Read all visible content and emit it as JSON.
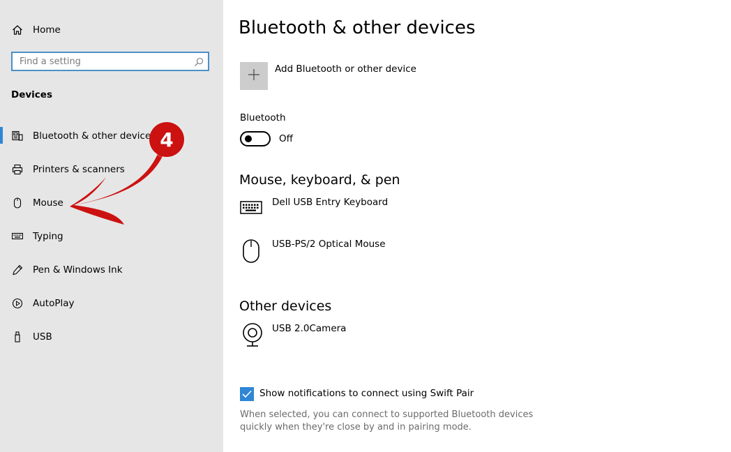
{
  "sidebar": {
    "home_label": "Home",
    "search_placeholder": "Find a setting",
    "group_title": "Devices",
    "items": [
      {
        "label": "Bluetooth & other devices",
        "icon": "bluetooth-devices-icon"
      },
      {
        "label": "Printers & scanners",
        "icon": "printer-icon"
      },
      {
        "label": "Mouse",
        "icon": "mouse-icon"
      },
      {
        "label": "Typing",
        "icon": "keyboard-icon"
      },
      {
        "label": "Pen & Windows Ink",
        "icon": "pen-icon"
      },
      {
        "label": "AutoPlay",
        "icon": "autoplay-icon"
      },
      {
        "label": "USB",
        "icon": "usb-icon"
      }
    ],
    "active_index": 0
  },
  "main": {
    "title": "Bluetooth & other devices",
    "add_device_label": "Add Bluetooth or other device",
    "bluetooth_label": "Bluetooth",
    "bluetooth_state": "Off",
    "mouse_section_title": "Mouse, keyboard, & pen",
    "mouse_devices": [
      {
        "label": "Dell USB Entry Keyboard",
        "icon": "keyboard-icon"
      },
      {
        "label": "USB-PS/2 Optical Mouse",
        "icon": "mouse-icon"
      }
    ],
    "other_section_title": "Other devices",
    "other_devices": [
      {
        "label": "USB 2.0Camera",
        "icon": "webcam-icon"
      }
    ],
    "swift_pair_label": "Show notifications to connect using Swift Pair",
    "swift_pair_checked": true,
    "swift_pair_description": "When selected, you can connect to supported Bluetooth devices quickly when they're close by and in pairing mode."
  },
  "annotation": {
    "step_number": "4"
  },
  "colors": {
    "sidebar_bg": "#e6e6e6",
    "accent": "#2f86d4",
    "annotation_red": "#cc1111"
  }
}
